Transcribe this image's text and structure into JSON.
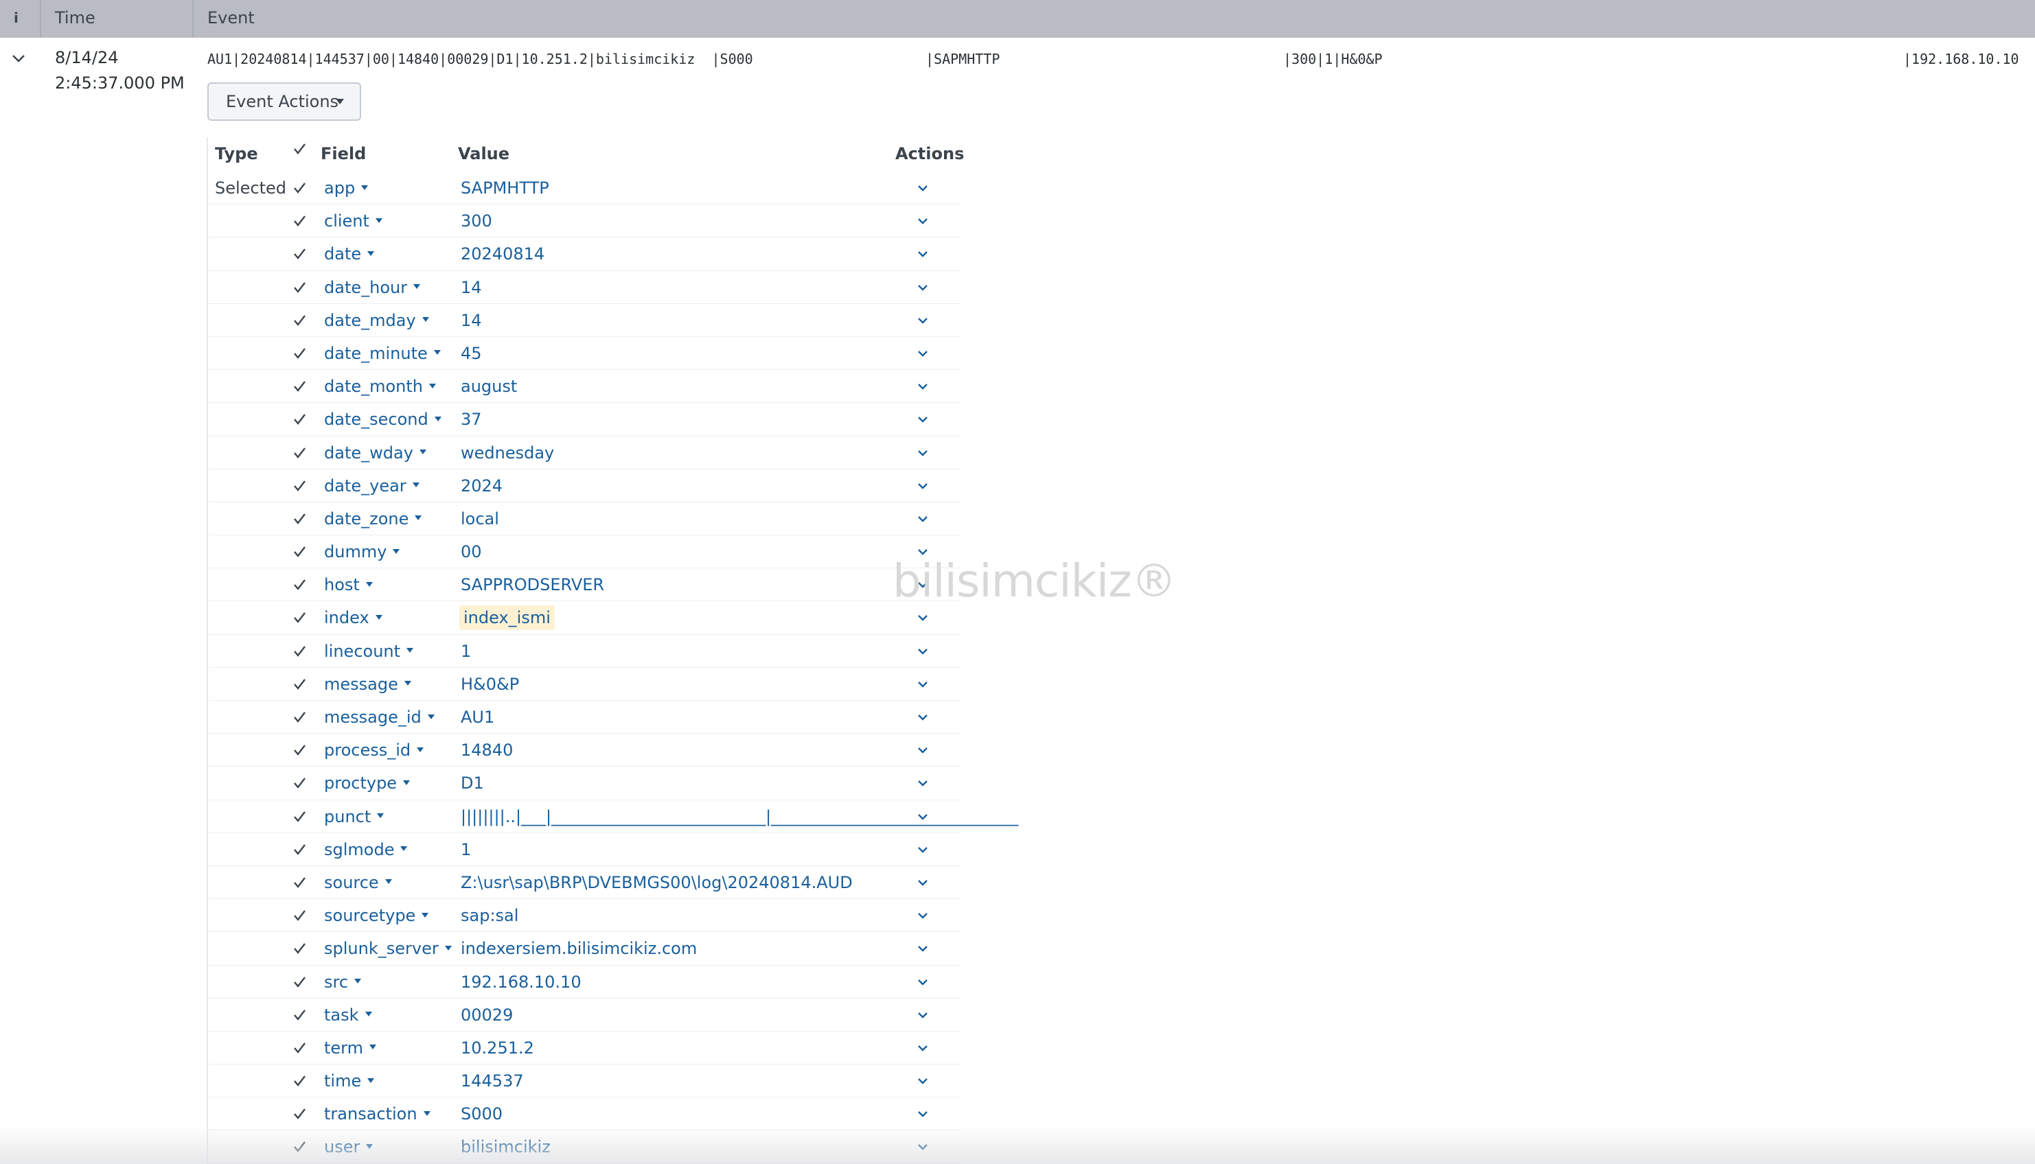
{
  "table": {
    "header": {
      "info": "i",
      "time": "Time",
      "event": "Event"
    }
  },
  "event": {
    "date": "8/14/24",
    "time": "2:45:37.000 PM",
    "raw": {
      "part1": "AU1|20240814|144537|00|14840|00029|D1|10.251.2|bilisimcikiz  |S000",
      "part2": "|SAPMHTTP",
      "part3": "|300|1|H&0&P",
      "part4": "|192.168.10.10"
    },
    "actions_label": "Event Actions"
  },
  "fields_table": {
    "headers": {
      "type": "Type",
      "field": "Field",
      "value": "Value",
      "actions": "Actions"
    },
    "type_selected": "Selected",
    "rows": [
      {
        "field": "app",
        "value": "SAPMHTTP"
      },
      {
        "field": "client",
        "value": "300"
      },
      {
        "field": "date",
        "value": "20240814"
      },
      {
        "field": "date_hour",
        "value": "14"
      },
      {
        "field": "date_mday",
        "value": "14"
      },
      {
        "field": "date_minute",
        "value": "45"
      },
      {
        "field": "date_month",
        "value": "august"
      },
      {
        "field": "date_second",
        "value": "37"
      },
      {
        "field": "date_wday",
        "value": "wednesday"
      },
      {
        "field": "date_year",
        "value": "2024"
      },
      {
        "field": "date_zone",
        "value": "local"
      },
      {
        "field": "dummy",
        "value": "00"
      },
      {
        "field": "host",
        "value": "SAPPRODSERVER"
      },
      {
        "field": "index",
        "value": "index_ismi"
      },
      {
        "field": "linecount",
        "value": "1"
      },
      {
        "field": "message",
        "value": "H&0&P"
      },
      {
        "field": "message_id",
        "value": "AU1"
      },
      {
        "field": "process_id",
        "value": "14840"
      },
      {
        "field": "proctype",
        "value": "D1"
      },
      {
        "field": "punct",
        "value": "||||||||..|___|__________________________|______________________________"
      },
      {
        "field": "sglmode",
        "value": "1"
      },
      {
        "field": "source",
        "value": "Z:\\usr\\sap\\BRP\\DVEBMGS00\\log\\20240814.AUD"
      },
      {
        "field": "sourcetype",
        "value": "sap:sal"
      },
      {
        "field": "splunk_server",
        "value": "indexersiem.bilisimcikiz.com"
      },
      {
        "field": "src",
        "value": "192.168.10.10"
      },
      {
        "field": "task",
        "value": "00029"
      },
      {
        "field": "term",
        "value": "10.251.2"
      },
      {
        "field": "time",
        "value": "144537"
      },
      {
        "field": "transaction",
        "value": "S000"
      },
      {
        "field": "user",
        "value": "bilisimcikiz"
      }
    ]
  },
  "watermark": "bilisimcikiz®",
  "colors": {
    "header_bg": "#b9bdc3",
    "link": "#1a5f9c",
    "highlight": "#fdf1d4"
  }
}
